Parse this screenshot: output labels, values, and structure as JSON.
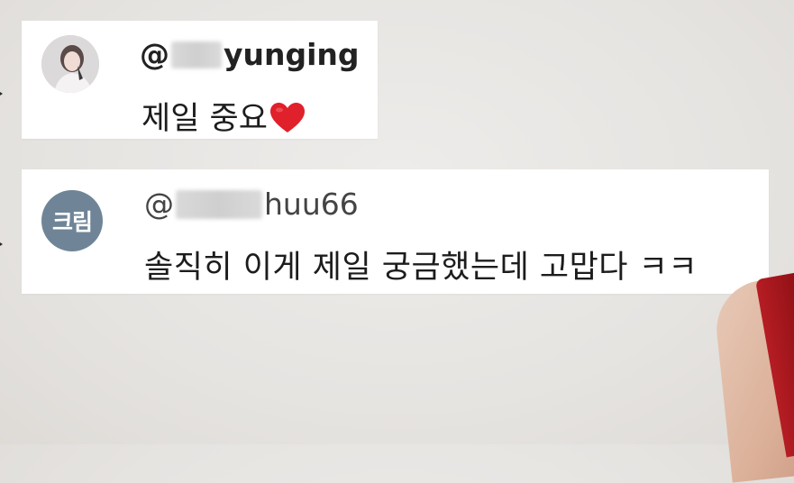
{
  "comments": [
    {
      "username_prefix": "@",
      "username_suffix": "yunging",
      "text": "제일 중요",
      "emoji_icon": "heart-icon"
    },
    {
      "username_prefix": "@",
      "username_suffix": "huu66",
      "avatar_text": "크림",
      "text": "솔직히 이게 제일 궁금했는데 고맙다 ㅋㅋ"
    }
  ],
  "colors": {
    "background": "#e8e6e3",
    "card": "#ffffff",
    "avatar2": "#6f8597",
    "heart": "#e0202a",
    "strap": "#b51d23"
  }
}
